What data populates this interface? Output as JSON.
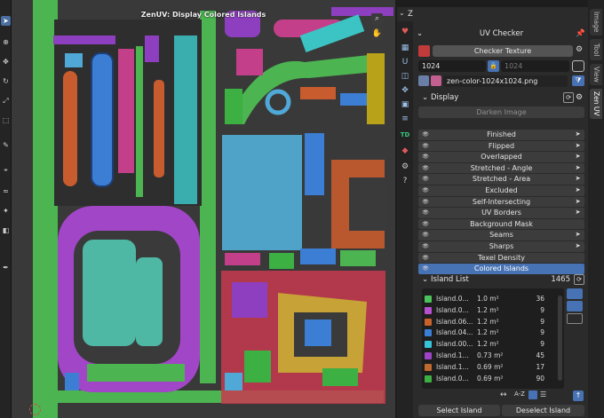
{
  "viewport": {
    "title": "ZenUV: Display Colored Islands"
  },
  "panel": {
    "tab_title": "Zen UV",
    "uv_checker": {
      "title": "UV Checker",
      "checker_button": "Checker Texture",
      "resolution_x": "1024",
      "resolution_y": "1024",
      "texture_name": "zen-color-1024x1024.png"
    },
    "display": {
      "title": "Display",
      "darken_button": "Darken Image",
      "toggles": [
        {
          "label": "Finished",
          "active": false
        },
        {
          "label": "Flipped",
          "active": false
        },
        {
          "label": "Overlapped",
          "active": false
        },
        {
          "label": "Stretched - Angle",
          "active": false
        },
        {
          "label": "Stretched - Area",
          "active": false
        },
        {
          "label": "Excluded",
          "active": false
        },
        {
          "label": "Self-Intersecting",
          "active": false
        },
        {
          "label": "UV Borders",
          "active": false
        },
        {
          "label": "Background Mask",
          "active": false
        },
        {
          "label": "Seams",
          "active": false
        },
        {
          "label": "Sharps",
          "active": false
        },
        {
          "label": "Texel Density",
          "active": false
        },
        {
          "label": "Colored Islands",
          "active": true
        }
      ]
    },
    "island_list": {
      "title": "Island List",
      "count": "1465",
      "rows": [
        {
          "name": "Island.0...",
          "area": "1.0 m²",
          "count": "36",
          "color": "#4bc35a"
        },
        {
          "name": "Island.0...",
          "area": "1.2 m²",
          "count": "9",
          "color": "#b64fd0"
        },
        {
          "name": "Island.06...",
          "area": "1.2 m²",
          "count": "9",
          "color": "#c9612a"
        },
        {
          "name": "Island.04...",
          "area": "1.2 m²",
          "count": "9",
          "color": "#3a7fd6"
        },
        {
          "name": "Island.00...",
          "area": "1.2 m²",
          "count": "9",
          "color": "#37c4d8"
        },
        {
          "name": "Island.1...",
          "area": "0.73 m²",
          "count": "45",
          "color": "#9d43c6"
        },
        {
          "name": "Island.1...",
          "area": "0.69 m²",
          "count": "17",
          "color": "#c06a2d"
        },
        {
          "name": "Island.0...",
          "area": "0.69 m²",
          "count": "90",
          "color": "#3cb043"
        }
      ]
    },
    "bottom": {
      "select": "Select Island",
      "deselect": "Deselect Island"
    }
  },
  "side_tabs": [
    "Image",
    "Tool",
    "View",
    "Zen UV"
  ],
  "icons": {
    "eye": "eye-icon",
    "arrow": "cursor-arrow-icon",
    "gear": "gear-icon",
    "chevron": "chevron-down-icon"
  }
}
